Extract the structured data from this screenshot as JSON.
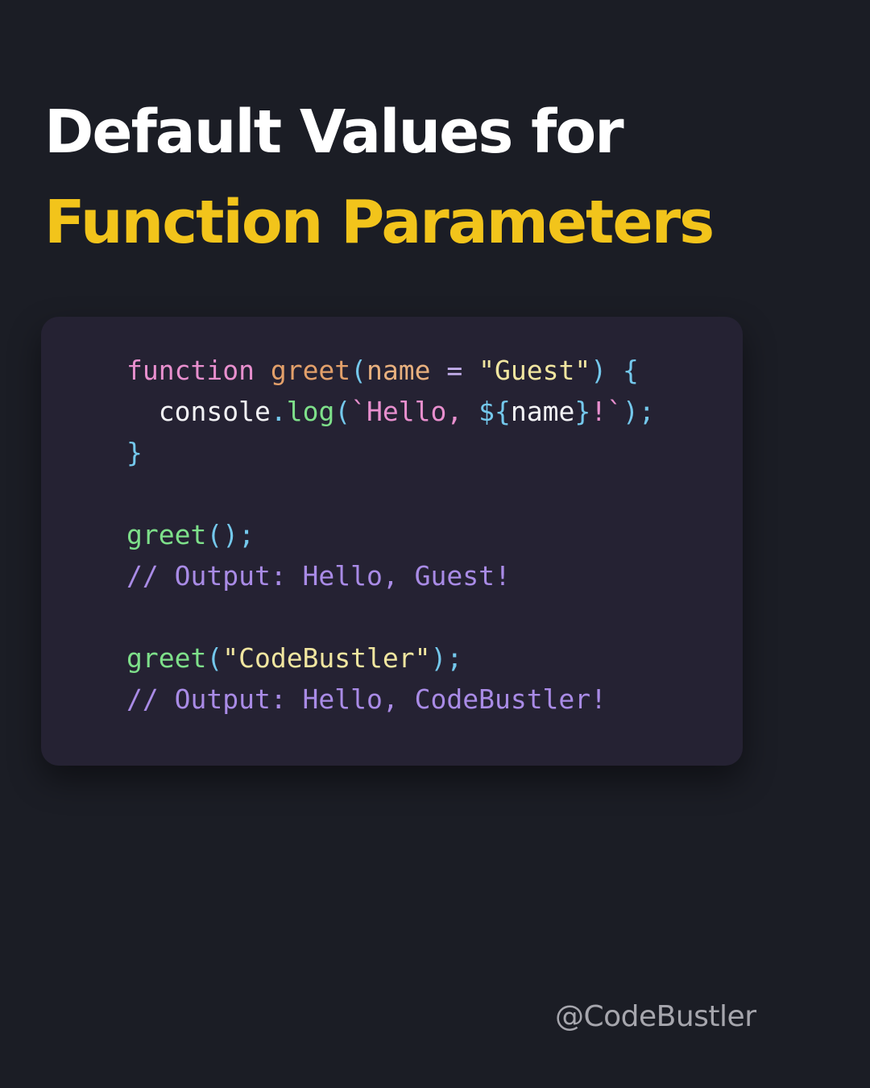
{
  "title": {
    "line1": "Default Values for",
    "line2": "Function Parameters"
  },
  "code": {
    "line1": {
      "keyword": "function",
      "fn": "greet",
      "open": "(",
      "param": "name",
      "op": "=",
      "default": "\"Guest\"",
      "close": ")",
      "brace": "{"
    },
    "line2": {
      "obj": "console",
      "dot": ".",
      "method": "log",
      "open": "(",
      "tmpl_open": "`Hello, ",
      "interp_open": "${",
      "var": "name",
      "interp_close": "}",
      "tmpl_close": "!`",
      "close": ")",
      "semi": ";"
    },
    "line3": {
      "brace": "}"
    },
    "line5": {
      "call": "greet",
      "parens": "()",
      "semi": ";"
    },
    "line6": {
      "comment": "// Output: Hello, Guest!"
    },
    "line8": {
      "call": "greet",
      "open": "(",
      "arg": "\"CodeBustler\"",
      "close": ")",
      "semi": ";"
    },
    "line9": {
      "comment": "// Output: Hello, CodeBustler!"
    }
  },
  "handle": "@CodeBustler",
  "colors": {
    "background": "#1b1d25",
    "card": "#252233",
    "title_white": "#ffffff",
    "title_accent": "#f2c41b",
    "keyword": "#e88fce",
    "function_call": "#7ee08a",
    "string": "#f1e6a0",
    "comment": "#a98be6",
    "punctuation": "#74c8ec"
  }
}
